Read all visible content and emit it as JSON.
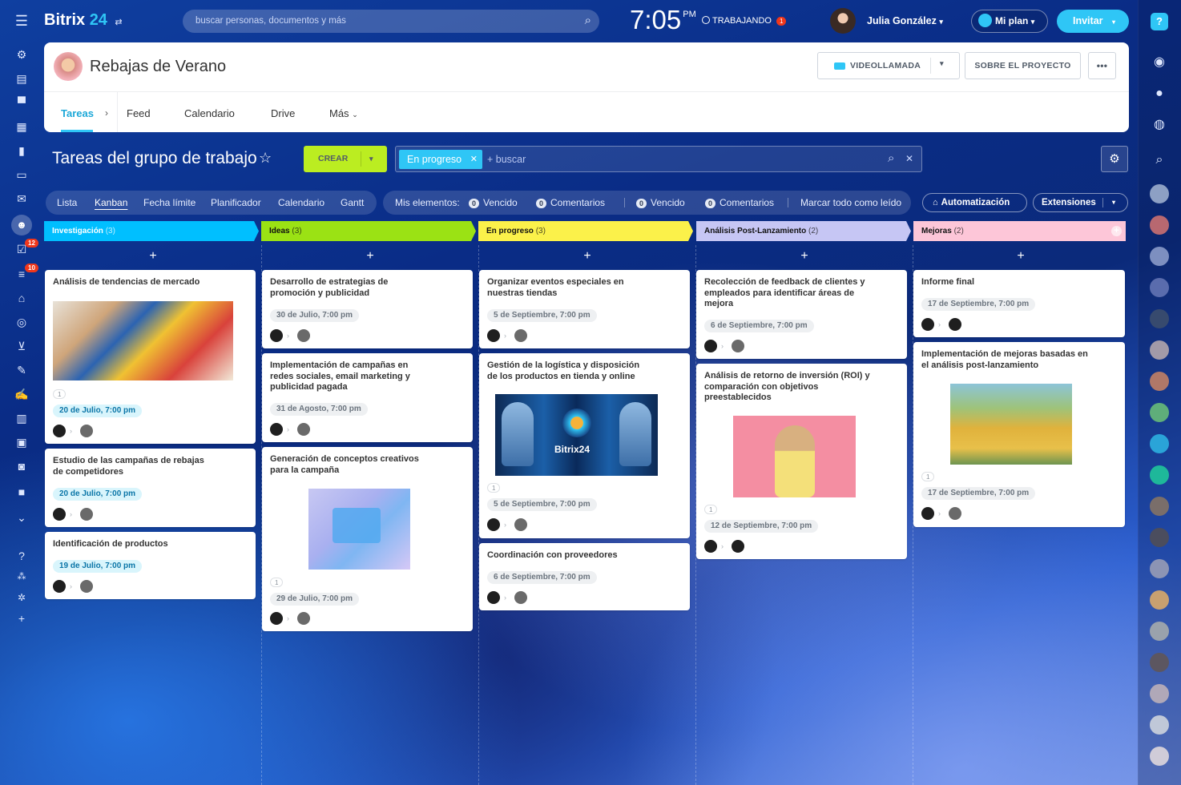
{
  "topbar": {
    "brand": "Bitrix",
    "brand_num": "24",
    "search_placeholder": "buscar personas, documentos y más",
    "clock": "7:05",
    "ampm": "PM",
    "status": "TRABAJANDO",
    "status_count": "1",
    "user": "Julia González",
    "plan": "Mi plan",
    "invite": "Invitar"
  },
  "sidebar": {
    "tasks_badge": "12",
    "lists_badge": "10"
  },
  "header": {
    "title": "Rebajas de Verano",
    "video_call": "VIDEOLLAMADA",
    "about": "SOBRE EL PROYECTO",
    "more": "•••"
  },
  "tabs": [
    "Tareas",
    "Feed",
    "Calendario",
    "Drive",
    "Más"
  ],
  "toolbar": {
    "title": "Tareas del grupo de trabajo",
    "create": "CREAR",
    "filter_tag": "En progreso",
    "search_placeholder": "+ buscar"
  },
  "views": [
    "Lista",
    "Kanban",
    "Fecha límite",
    "Planificador",
    "Calendario",
    "Gantt"
  ],
  "counters": {
    "label": "Mis elementos:",
    "items": [
      {
        "n": "0",
        "label": "Vencido"
      },
      {
        "n": "0",
        "label": "Comentarios"
      },
      {
        "n": "0",
        "label": "Vencido"
      },
      {
        "n": "0",
        "label": "Comentarios"
      }
    ],
    "mark_read": "Marcar todo como leído"
  },
  "automation": "Automatización",
  "extensions": "Extensiones",
  "columns": [
    {
      "name": "Investigación",
      "count": "(3)",
      "color": "#00bfff"
    },
    {
      "name": "Ideas",
      "count": "(3)",
      "color": "#9be214"
    },
    {
      "name": "En progreso",
      "count": "(3)",
      "color": "#fbf14a"
    },
    {
      "name": "Análisis Post-Lanzamiento",
      "count": "(2)",
      "color": "#c6c6f4"
    },
    {
      "name": "Mejoras",
      "count": "(2)",
      "color": "#fdc6d8"
    }
  ],
  "cards": {
    "c1": {
      "title": "Análisis de tendencias de mercado",
      "count": "1",
      "date": "20 de Julio, 7:00 pm"
    },
    "c2": {
      "title": "Estudio de las campañas de rebajas de competidores",
      "date": "20 de Julio, 7:00 pm"
    },
    "c3": {
      "title": "Identificación de productos",
      "date": "19 de Julio, 7:00 pm"
    },
    "c4": {
      "title": "Desarrollo de estrategias de promoción y publicidad",
      "date": "30 de Julio, 7:00 pm"
    },
    "c5": {
      "title": "Implementación de campañas en redes sociales, email marketing y publicidad pagada",
      "date": "31 de Agosto, 7:00 pm"
    },
    "c6": {
      "title": "Generación de conceptos creativos para la campaña",
      "count": "1",
      "date": "29 de Julio, 7:00 pm"
    },
    "c7": {
      "title": "Organizar eventos especiales en nuestras tiendas",
      "date": "5 de Septiembre, 7:00 pm"
    },
    "c8": {
      "title": "Gestión de la logística y disposición de los productos en tienda y online",
      "count": "1",
      "date": "5 de Septiembre, 7:00 pm",
      "image_text": "Bitrix24"
    },
    "c9": {
      "title": "Coordinación con proveedores",
      "date": "6 de Septiembre, 7:00 pm"
    },
    "c10": {
      "title": "Recolección de feedback de clientes y empleados para identificar áreas de mejora",
      "date": "6 de Septiembre, 7:00 pm"
    },
    "c11": {
      "title": "Análisis de retorno de inversión (ROI) y comparación con objetivos preestablecidos",
      "count": "1",
      "date": "12 de Septiembre, 7:00 pm"
    },
    "c12": {
      "title": "Informe final",
      "date": "17 de Septiembre, 7:00 pm"
    },
    "c13": {
      "title": "Implementación de mejoras basadas en el análisis post-lanzamiento",
      "count": "1",
      "date": "17 de Septiembre, 7:00 pm"
    }
  }
}
